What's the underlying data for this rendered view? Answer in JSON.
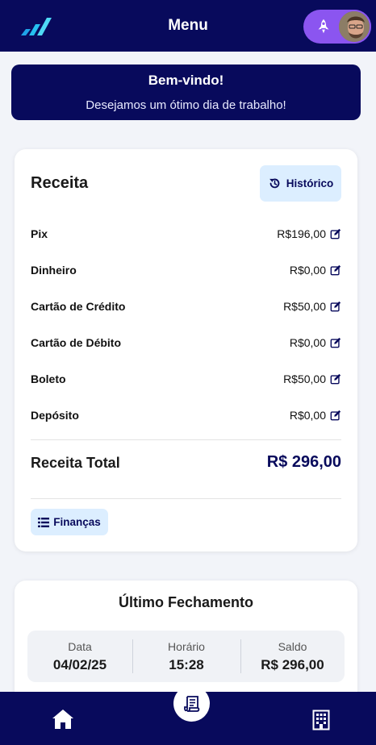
{
  "header": {
    "title": "Menu"
  },
  "welcome": {
    "title": "Bem-vindo!",
    "subtitle": "Desejamos um ótimo dia de trabalho!"
  },
  "receita": {
    "title": "Receita",
    "history_label": "Histórico",
    "items": [
      {
        "label": "Pix",
        "value": "R$196,00"
      },
      {
        "label": "Dinheiro",
        "value": "R$0,00"
      },
      {
        "label": "Cartão de Crédito",
        "value": "R$50,00"
      },
      {
        "label": "Cartão de Débito",
        "value": "R$0,00"
      },
      {
        "label": "Boleto",
        "value": "R$50,00"
      },
      {
        "label": "Depósito",
        "value": "R$0,00"
      }
    ],
    "total_label": "Receita Total",
    "total_value": "R$ 296,00",
    "finance_label": "Finanças"
  },
  "fechamento": {
    "title": "Último Fechamento",
    "cols": [
      {
        "label": "Data",
        "value": "04/02/25"
      },
      {
        "label": "Horário",
        "value": "15:28"
      },
      {
        "label": "Saldo",
        "value": "R$ 296,00"
      }
    ]
  },
  "colors": {
    "navy": "#080a5c",
    "accent_light": "#dceeff",
    "purple": "#8b55f0"
  },
  "icons": [
    "logo-icon",
    "rocket-icon",
    "avatar",
    "history-icon",
    "edit-icon",
    "list-icon",
    "home-icon",
    "receipt-icon",
    "building-icon"
  ]
}
